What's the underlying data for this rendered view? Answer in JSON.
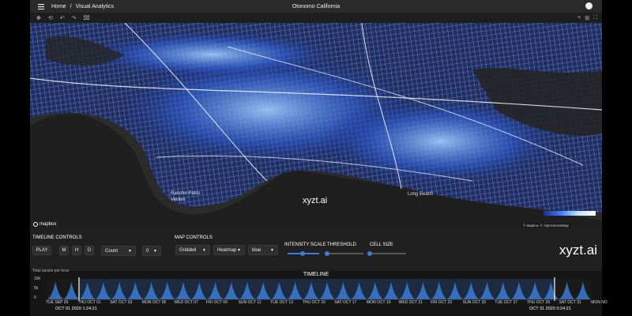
{
  "header": {
    "home": "Home",
    "separator": "/",
    "section": "Visual Analytics",
    "title": "Otonomo California"
  },
  "map": {
    "brand": "xyzt.ai",
    "mapbox_label": "mapbox",
    "attribution": "© Mapbox © OpenStreetMap",
    "places": {
      "palos_verdes_line1": "Rancho Palos",
      "palos_verdes_line2": "Verdes",
      "long_beach": "Long Beach"
    },
    "accent": "#3a7bd5"
  },
  "controls": {
    "timeline_label": "TIMELINE CONTROLS",
    "play": "PLAY",
    "period_buttons": [
      "M",
      "H",
      "D"
    ],
    "metric": "Count",
    "offset": "0",
    "map_label": "MAP CONTROLS",
    "grid_mode": "Gridded",
    "viz_mode": "Heatmap",
    "palette": "blue",
    "intensity_label": "INTENSITY SCALE",
    "threshold_label": "THRESHOLD",
    "cell_size_label": "CELL SIZE",
    "brand": "xyzt.ai"
  },
  "timeline": {
    "title": "TIMELINE",
    "subtitle": "Total assets per hour",
    "y_ticks": [
      "10k",
      "5k",
      "0"
    ],
    "start_label": "OCT 01 2020 1:24:21",
    "end_label": "OCT 31 2020 0:24:21",
    "date_ticks": [
      "TUE SEP 29",
      "THU OCT 01",
      "SAT OCT 03",
      "MON OCT 05",
      "WED OCT 07",
      "FRI OCT 09",
      "SUN OCT 11",
      "TUE OCT 13",
      "THU OCT 15",
      "SAT OCT 17",
      "MON OCT 19",
      "WED OCT 21",
      "FRI OCT 23",
      "SUN OCT 25",
      "TUE OCT 27",
      "THU OCT 29",
      "SAT OCT 31",
      "MON NO"
    ]
  }
}
